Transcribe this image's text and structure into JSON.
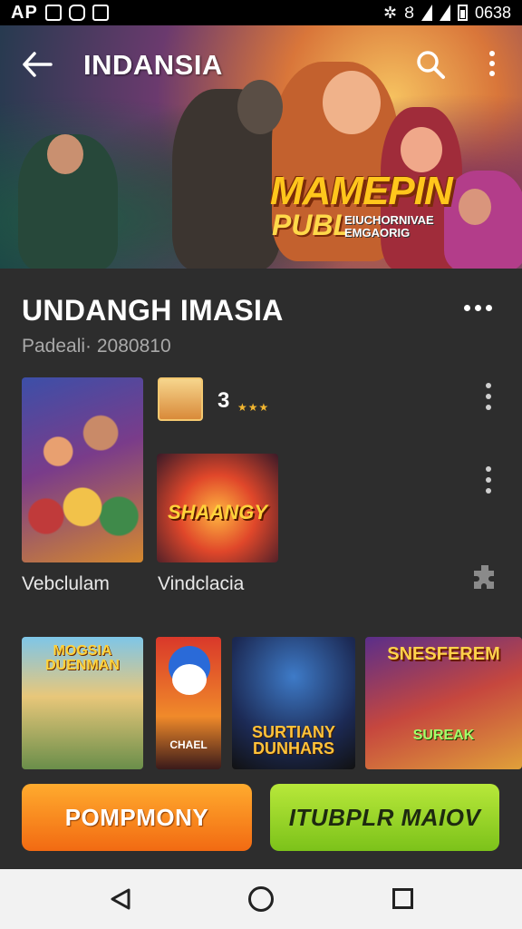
{
  "status_bar": {
    "carrier": "AP",
    "time": "0638"
  },
  "app_bar": {
    "title": "INDANSIA"
  },
  "hero": {
    "logo_line1": "MAMEPIN",
    "logo_line2": "PUBL",
    "logo_tag": "EIUCHORNIVAE EMGAORIG"
  },
  "section": {
    "title": "UNDANGH IMASIA",
    "subtitle": "Padeali· 2080810"
  },
  "featured": {
    "rating": "3",
    "stars": "★★★",
    "tile2_text": "SHAANGY",
    "labels": [
      "Vebclulam",
      "Vindclacia"
    ]
  },
  "row_tiles": [
    {
      "text": "MOGSIA DUENMAN"
    },
    {
      "text": "CHAEL"
    },
    {
      "text": "SURTIANY DUNHARS"
    },
    {
      "text": "SNESFEREM",
      "text2": "SUREAK"
    }
  ],
  "buttons": {
    "primary": "POMPMONY",
    "secondary": "ITUBPLR MAIOV"
  },
  "colors": {
    "accent_orange": "#f26a12",
    "accent_green": "#7cc21a",
    "background": "#2d2d2d"
  }
}
